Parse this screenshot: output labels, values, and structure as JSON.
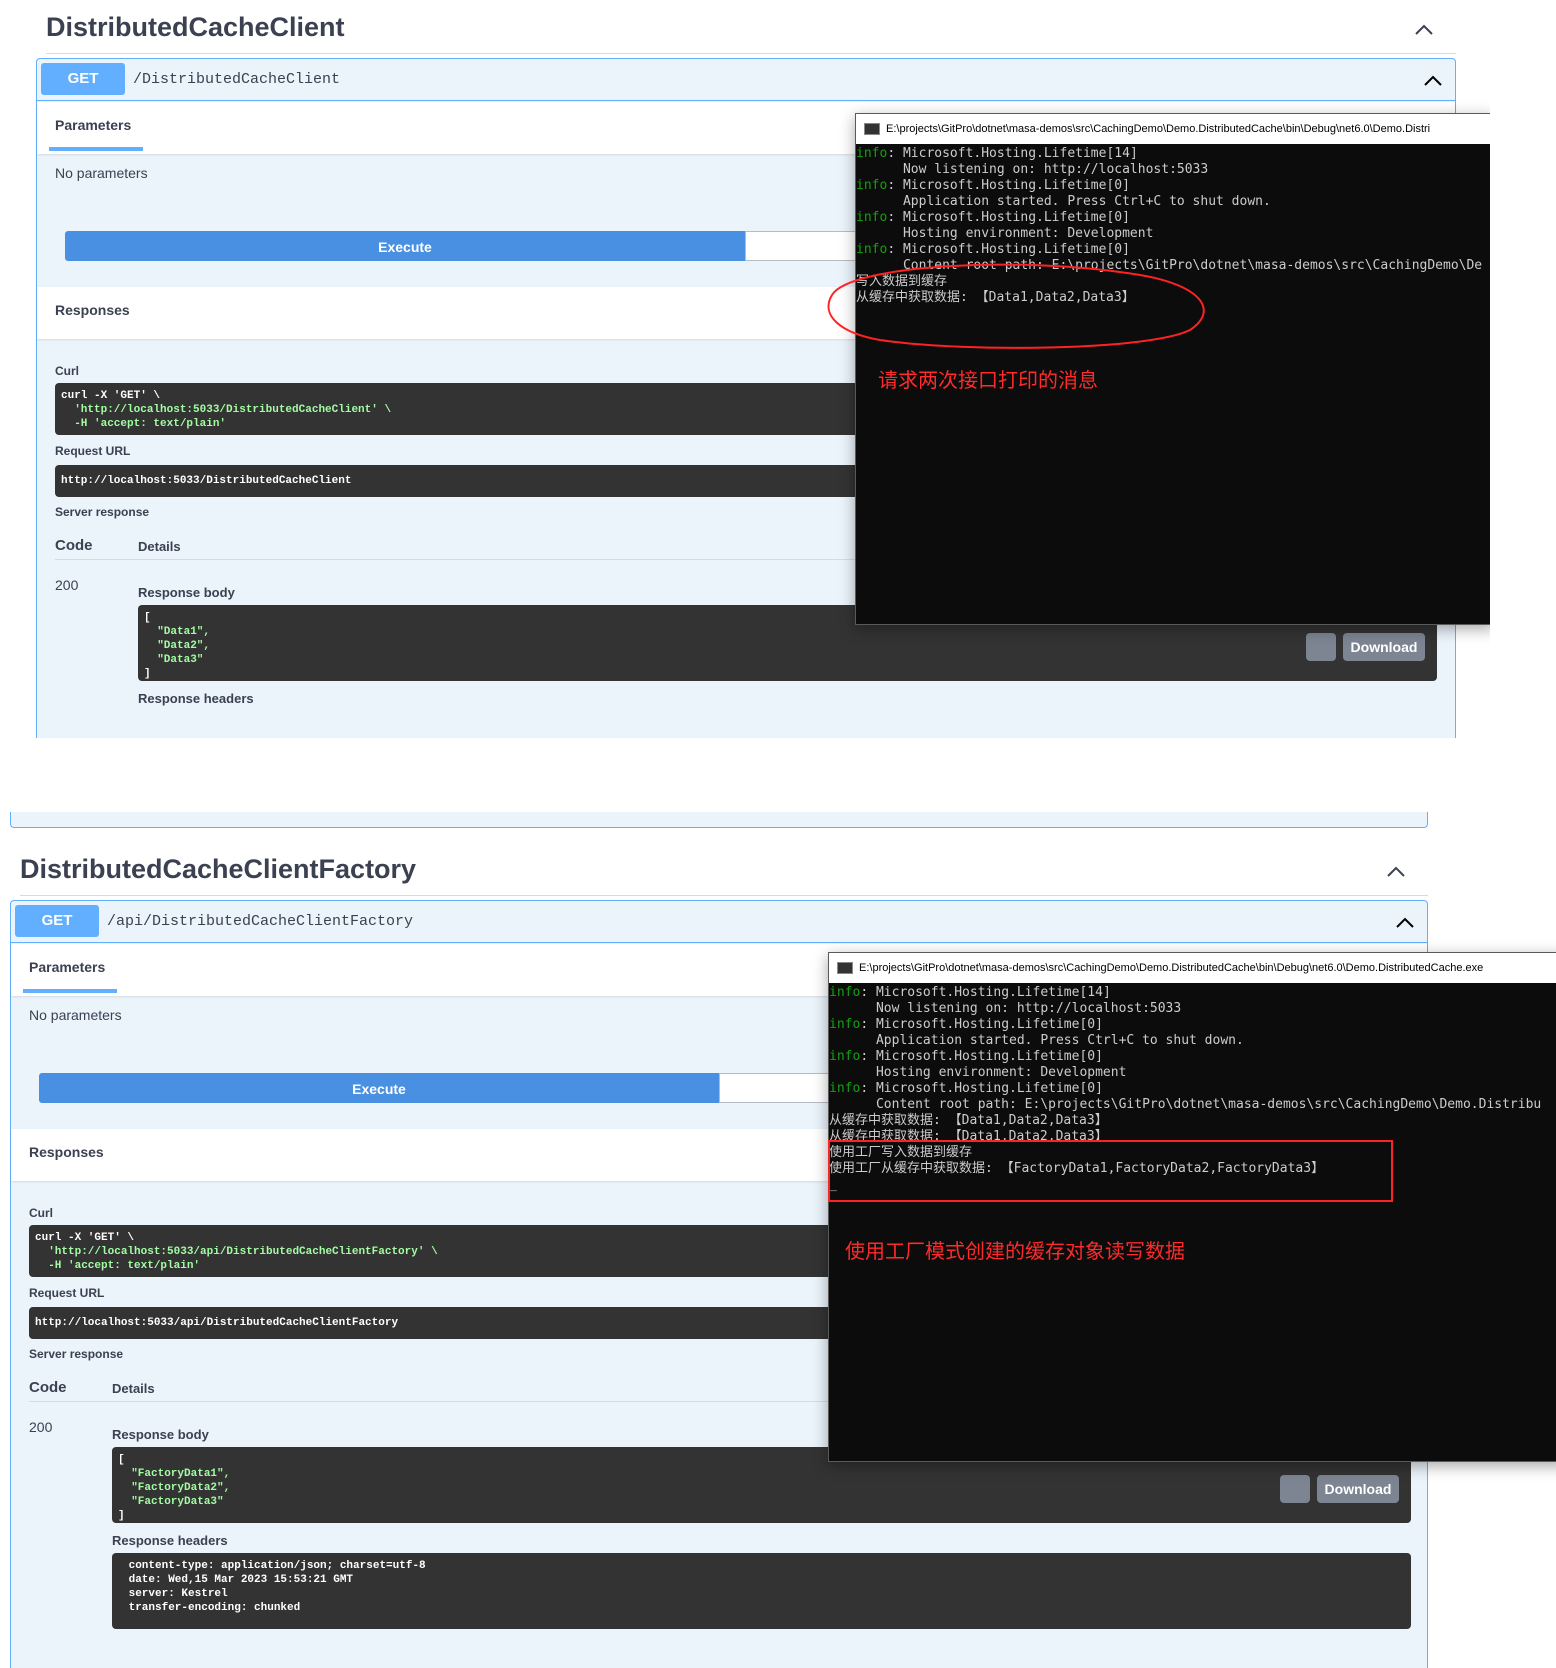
{
  "top": {
    "tag_title": "DistributedCacheClient",
    "method": "GET",
    "path": "/DistributedCacheClient",
    "parameters_tab": "Parameters",
    "no_params": "No parameters",
    "execute": "Execute",
    "responses": "Responses",
    "curl_label": "Curl",
    "curl_line1": "curl -X 'GET' \\",
    "curl_line2": "  'http://localhost:5033/DistributedCacheClient' \\",
    "curl_line3": "  -H 'accept: text/plain'",
    "request_url_label": "Request URL",
    "request_url": "http://localhost:5033/DistributedCacheClient",
    "server_response_label": "Server response",
    "code_head": "Code",
    "details_head": "Details",
    "status": "200",
    "response_body_label": "Response body",
    "body_open": "[",
    "body_items": [
      "  \"Data1\",",
      "  \"Data2\",",
      "  \"Data3\""
    ],
    "body_close": "]",
    "download": "Download",
    "response_headers_label": "Response headers",
    "console_title": "E:\\projects\\GitPro\\dotnet\\masa-demos\\src\\CachingDemo\\Demo.DistributedCache\\bin\\Debug\\net6.0\\Demo.Distri",
    "console_lines": [
      {
        "tag": "info",
        "text": ": Microsoft.Hosting.Lifetime[14]"
      },
      {
        "tag": "",
        "text": "      Now listening on: http://localhost:5033"
      },
      {
        "tag": "info",
        "text": ": Microsoft.Hosting.Lifetime[0]"
      },
      {
        "tag": "",
        "text": "      Application started. Press Ctrl+C to shut down."
      },
      {
        "tag": "info",
        "text": ": Microsoft.Hosting.Lifetime[0]"
      },
      {
        "tag": "",
        "text": "      Hosting environment: Development"
      },
      {
        "tag": "info",
        "text": ": Microsoft.Hosting.Lifetime[0]"
      },
      {
        "tag": "",
        "text": "      Content root path: E:\\projects\\GitPro\\dotnet\\masa-demos\\src\\CachingDemo\\De"
      },
      {
        "tag": "",
        "text": "写入数据到缓存"
      },
      {
        "tag": "",
        "text": "从缓存中获取数据: 【Data1,Data2,Data3】"
      }
    ],
    "annotation": "请求两次接口打印的消息"
  },
  "bottom": {
    "tag_title": "DistributedCacheClientFactory",
    "method": "GET",
    "path": "/api/DistributedCacheClientFactory",
    "parameters_tab": "Parameters",
    "no_params": "No parameters",
    "execute": "Execute",
    "responses": "Responses",
    "curl_label": "Curl",
    "curl_line1": "curl -X 'GET' \\",
    "curl_line2": "  'http://localhost:5033/api/DistributedCacheClientFactory' \\",
    "curl_line3": "  -H 'accept: text/plain'",
    "request_url_label": "Request URL",
    "request_url": "http://localhost:5033/api/DistributedCacheClientFactory",
    "server_response_label": "Server response",
    "code_head": "Code",
    "details_head": "Details",
    "status": "200",
    "response_body_label": "Response body",
    "body_open": "[",
    "body_items": [
      "  \"FactoryData1\",",
      "  \"FactoryData2\",",
      "  \"FactoryData3\""
    ],
    "body_close": "]",
    "download": "Download",
    "response_headers_label": "Response headers",
    "headers_lines": [
      " content-type: application/json; charset=utf-8",
      " date: Wed,15 Mar 2023 15:53:21 GMT",
      " server: Kestrel",
      " transfer-encoding: chunked"
    ],
    "console_title": "E:\\projects\\GitPro\\dotnet\\masa-demos\\src\\CachingDemo\\Demo.DistributedCache\\bin\\Debug\\net6.0\\Demo.DistributedCache.exe",
    "console_lines": [
      {
        "tag": "info",
        "text": ": Microsoft.Hosting.Lifetime[14]"
      },
      {
        "tag": "",
        "text": "      Now listening on: http://localhost:5033"
      },
      {
        "tag": "info",
        "text": ": Microsoft.Hosting.Lifetime[0]"
      },
      {
        "tag": "",
        "text": "      Application started. Press Ctrl+C to shut down."
      },
      {
        "tag": "info",
        "text": ": Microsoft.Hosting.Lifetime[0]"
      },
      {
        "tag": "",
        "text": "      Hosting environment: Development"
      },
      {
        "tag": "info",
        "text": ": Microsoft.Hosting.Lifetime[0]"
      },
      {
        "tag": "",
        "text": "      Content root path: E:\\projects\\GitPro\\dotnet\\masa-demos\\src\\CachingDemo\\Demo.Distribu"
      },
      {
        "tag": "",
        "text": "从缓存中获取数据: 【Data1,Data2,Data3】"
      },
      {
        "tag": "",
        "text": "从缓存中获取数据: 【Data1,Data2,Data3】"
      },
      {
        "tag": "",
        "text": "使用工厂写入数据到缓存"
      },
      {
        "tag": "",
        "text": "使用工厂从缓存中获取数据: 【FactoryData1,FactoryData2,FactoryData3】"
      },
      {
        "tag": "",
        "text": "_"
      }
    ],
    "annotation": "使用工厂模式创建的缓存对象读写数据"
  },
  "colors": {
    "get_blue": "#61affe",
    "execute_blue": "#4990e2",
    "annotation_red": "#ff2a2a",
    "console_green": "#13a10e"
  },
  "icons": [
    "chevron-up-icon",
    "copy-icon",
    "console-app-icon"
  ]
}
